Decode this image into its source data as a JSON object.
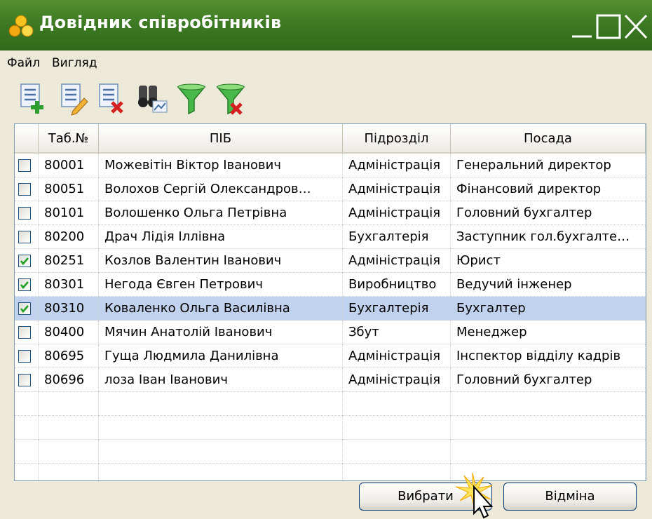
{
  "window": {
    "title": "Довідник співробітників"
  },
  "menu": {
    "items": [
      "Файл",
      "Вигляд"
    ]
  },
  "toolbar": {
    "buttons": [
      "add-record-icon",
      "edit-record-icon",
      "delete-record-icon",
      "find-icon",
      "filter-icon",
      "clear-filter-icon"
    ]
  },
  "table": {
    "headers": [
      "Таб.№",
      "ПІБ",
      "Підрозділ",
      "Посада"
    ],
    "rows": [
      {
        "checked": false,
        "tab": "80001",
        "name": "Можевітін Віктор Іванович",
        "dept": "Адміністрація",
        "position": "Генеральний директор"
      },
      {
        "checked": false,
        "tab": "80051",
        "name": "Волохов Сергій Олександров…",
        "dept": "Адміністрація",
        "position": "Фінансовий директор"
      },
      {
        "checked": false,
        "tab": "80101",
        "name": "Волошенко Ольга Петрівна",
        "dept": "Адміністрація",
        "position": "Головний бухгалтер"
      },
      {
        "checked": false,
        "tab": "80200",
        "name": "Драч Лідія Іллівна",
        "dept": "Бухгалтерія",
        "position": "Заступник гол.бухгалте…"
      },
      {
        "checked": true,
        "tab": "80251",
        "name": "Козлов Валентин Іванович",
        "dept": "Адміністрація",
        "position": "Юрист"
      },
      {
        "checked": true,
        "tab": "80301",
        "name": "Негода Євген Петрович",
        "dept": "Виробництво",
        "position": "Ведучий інженер"
      },
      {
        "checked": true,
        "tab": "80310",
        "name": "Коваленко Ольга Василівна",
        "dept": "Бухгалтерія",
        "position": "Бухгалтер"
      },
      {
        "checked": false,
        "tab": "80400",
        "name": "Мячин Анатолій Іванович",
        "dept": "Збут",
        "position": "Менеджер"
      },
      {
        "checked": false,
        "tab": "80695",
        "name": "Гуща Людмила Данилівна",
        "dept": "Адміністрація",
        "position": "Інспектор відділу кадрів"
      },
      {
        "checked": false,
        "tab": "80696",
        "name": "лоза Іван Іванович",
        "dept": "Адміністрація",
        "position": "Головний бухгалтер"
      }
    ],
    "selected_tab": "80310"
  },
  "buttons": {
    "select": "Вибрати",
    "cancel": "Відміна"
  },
  "colors": {
    "titlebar": "#3d7a23",
    "selection": "#c1d2ee",
    "checkmark": "#21a121"
  }
}
